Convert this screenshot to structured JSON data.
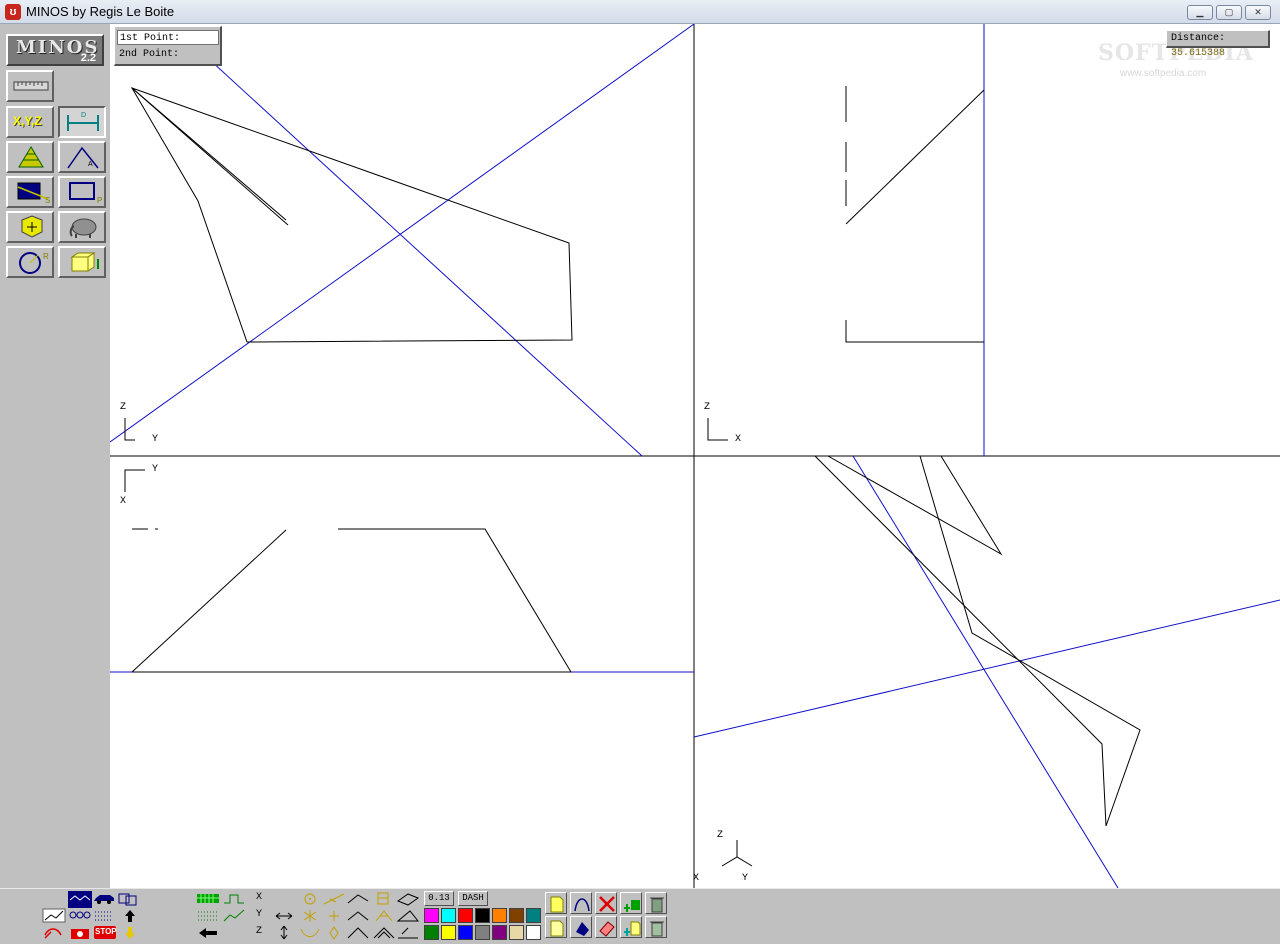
{
  "window": {
    "title": "MINOS by Regis Le Boite",
    "minimize_glyph": "▁",
    "maximize_glyph": "▢",
    "close_glyph": "✕"
  },
  "logo": {
    "name": "MINOS",
    "version": "2.2"
  },
  "points": {
    "first_label": "1st Point:",
    "second_label": "2nd Point:"
  },
  "distance": {
    "label": "Distance:",
    "value": "35.615388"
  },
  "watermark": {
    "text": "SOFTPEDIA",
    "url": "www.softpedia.com"
  },
  "left_toolbar": {
    "xyz_label": "X,Y,Z",
    "tools": [
      "ruler-icon",
      "xyz-coords-icon",
      "distance-icon",
      "pyramid-icon",
      "angle-icon",
      "plane-s-icon",
      "plane-p-icon",
      "cube-center-icon",
      "elephant-icon",
      "circle-r-icon",
      "box-icon"
    ]
  },
  "views": {
    "top_left": {
      "axis_v": "Z",
      "axis_h": "Y"
    },
    "top_right": {
      "axis_v": "Z",
      "axis_h": "X"
    },
    "bottom_left": {
      "axis_h": "Y",
      "axis_v": "X"
    },
    "bottom_right": {
      "axis_up": "Z",
      "axis_left": "X",
      "axis_right": "Y"
    }
  },
  "bottom_toolbar": {
    "axis_x": "X",
    "axis_y": "Y",
    "axis_z": "Z",
    "line_width": "0.13",
    "line_style": "DASH",
    "stop_label": "STOP",
    "palette": [
      "#ff00ff",
      "#00ffff",
      "#ff0000",
      "#000000",
      "#ff8000",
      "#804000",
      "#008080",
      "#008000",
      "#ffff00",
      "#0000ff",
      "#808080",
      "#800080",
      "#e8d8a8",
      "#ffffff"
    ]
  },
  "colors": {
    "construction_line": "#1010c8",
    "geometry": "#000000",
    "canvas": "#ffffff",
    "chrome": "#c0c0c0"
  }
}
